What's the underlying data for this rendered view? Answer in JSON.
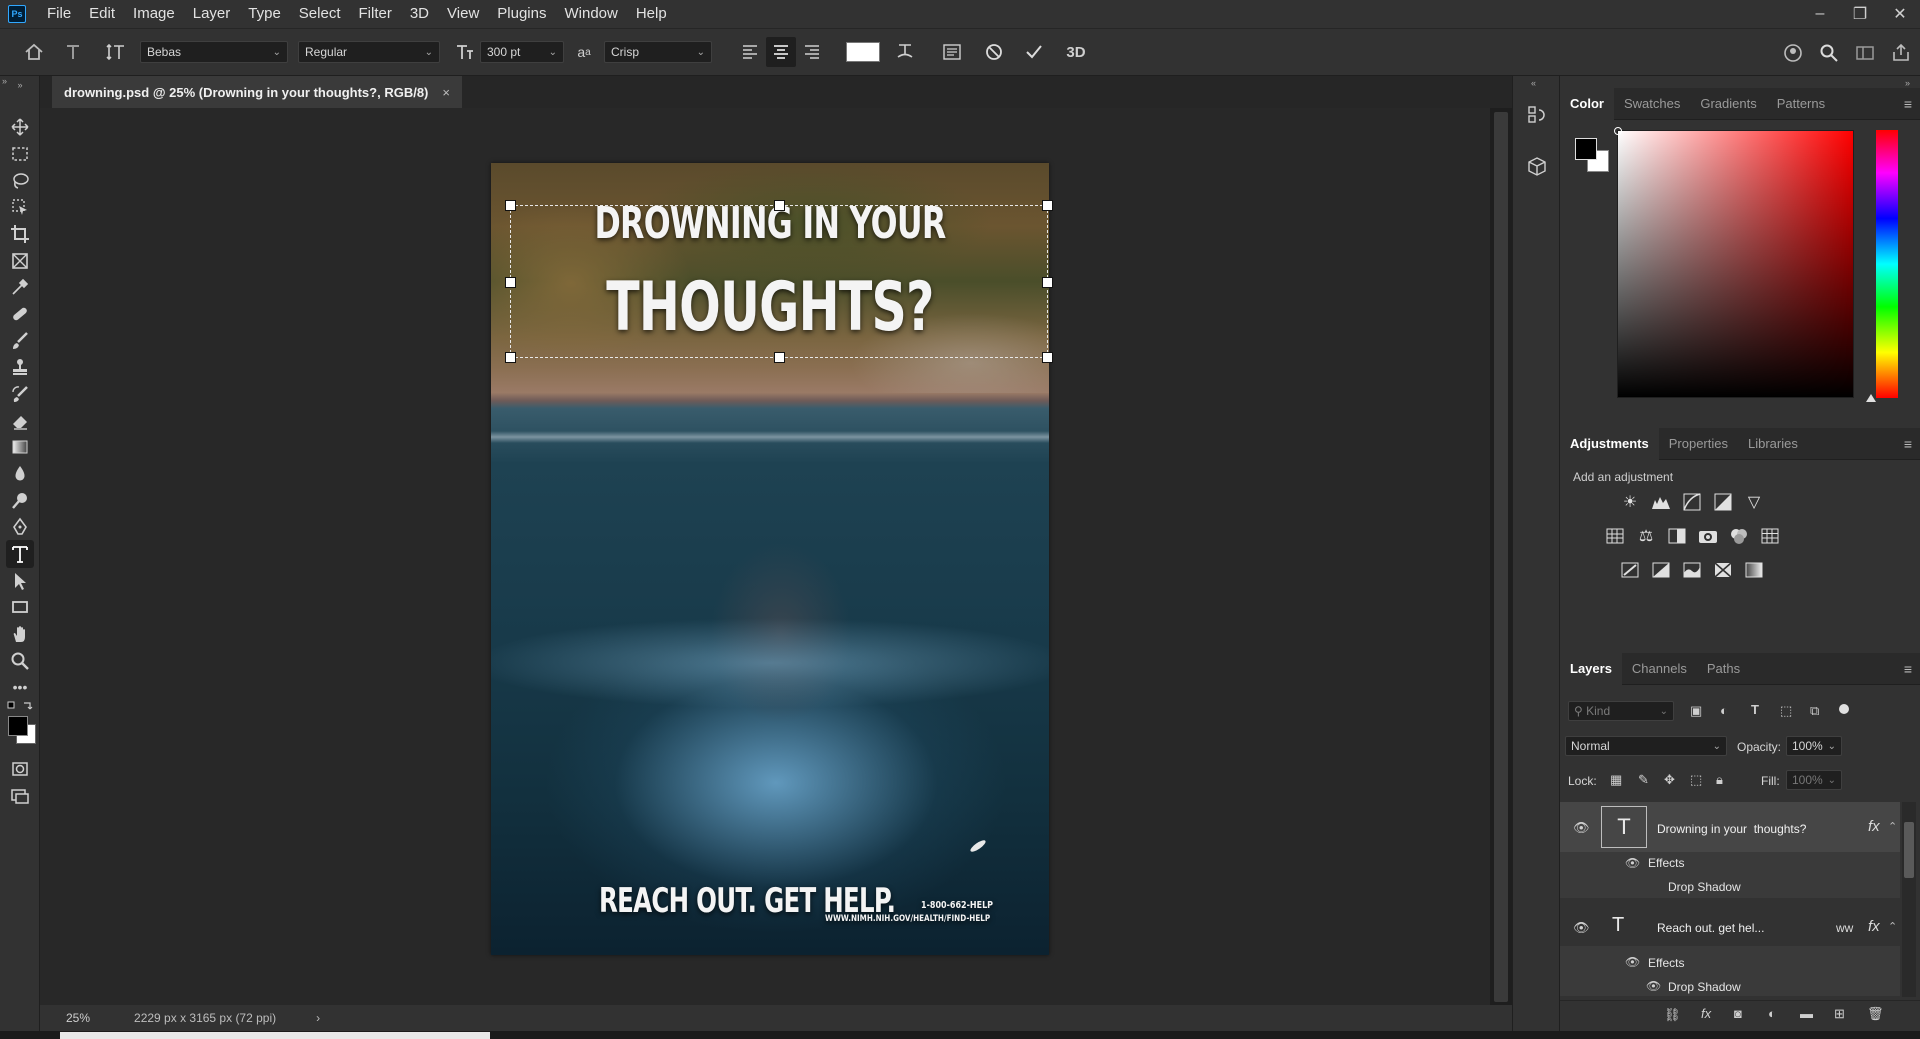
{
  "menubar": {
    "logo": "Ps",
    "items": [
      "File",
      "Edit",
      "Image",
      "Layer",
      "Type",
      "Select",
      "Filter",
      "3D",
      "View",
      "Plugins",
      "Window",
      "Help"
    ],
    "minimize": "–",
    "restore": "❐",
    "close": "✕"
  },
  "options": {
    "font_family": "Bebas",
    "font_style": "Regular",
    "font_size": "300 pt",
    "antialias": "Crisp",
    "mode_3d": "3D"
  },
  "document": {
    "tab_title": "drowning.psd @ 25% (Drowning in your  thoughts?, RGB/8)",
    "tab_close": "×",
    "zoom": "25%",
    "doc_info": "2229 px x 3165 px (72 ppi)",
    "info_arrow": "›"
  },
  "poster": {
    "headline_line1": "DROWNING IN YOUR",
    "headline_line2": "THOUGHTS?",
    "cta": "REACH OUT. GET HELP.",
    "phone": "1-800-662-HELP",
    "url": "WWW.NIMH.NIH.GOV/HEALTH/FIND-HELP"
  },
  "color_panel": {
    "tabs": [
      "Color",
      "Swatches",
      "Gradients",
      "Patterns"
    ],
    "foreground": "#000000",
    "background": "#ffffff"
  },
  "adjustments_panel": {
    "tabs": [
      "Adjustments",
      "Properties",
      "Libraries"
    ],
    "hint": "Add an adjustment"
  },
  "layers_panel": {
    "tabs": [
      "Layers",
      "Channels",
      "Paths"
    ],
    "filter_placeholder": "Kind",
    "blend_mode": "Normal",
    "opacity_label": "Opacity:",
    "opacity_value": "100%",
    "lock_label": "Lock:",
    "fill_label": "Fill:",
    "fill_value": "100%",
    "layers": [
      {
        "name": "Drowning in your  thoughts?",
        "effects_label": "Effects",
        "effect": "Drop Shadow",
        "fx": "fx",
        "warp": ""
      },
      {
        "name": "Reach out. get hel...",
        "effects_label": "Effects",
        "effect": "Drop Shadow",
        "fx": "fx",
        "warp": "ww"
      }
    ]
  }
}
